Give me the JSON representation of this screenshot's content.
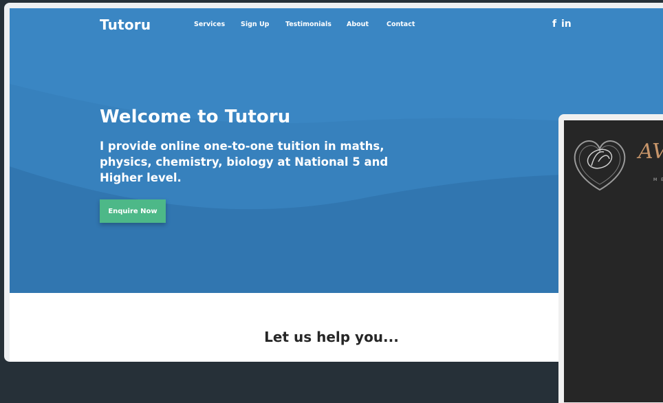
{
  "site": {
    "logo": "Tutoru",
    "nav": [
      "Services",
      "Sign Up",
      "Testimonials",
      "About",
      "Contact"
    ],
    "social": {
      "facebook": "f",
      "linkedin": "in"
    }
  },
  "hero": {
    "title": "Welcome to Tutoru",
    "subtitle": "I provide online one-to-one tuition in maths, physics, chemistry, biology at National 5 and Higher level.",
    "cta": "Enquire Now"
  },
  "section": {
    "heading": "Let us help you..."
  },
  "side_panel": {
    "brand_letters": "AV",
    "brand_sub": "M E"
  },
  "colors": {
    "hero_blue": "#3a86c3",
    "cta_green": "#4db888",
    "page_background": "#263038",
    "panel_dark": "#262626",
    "brand_gold": "#c7956a"
  }
}
